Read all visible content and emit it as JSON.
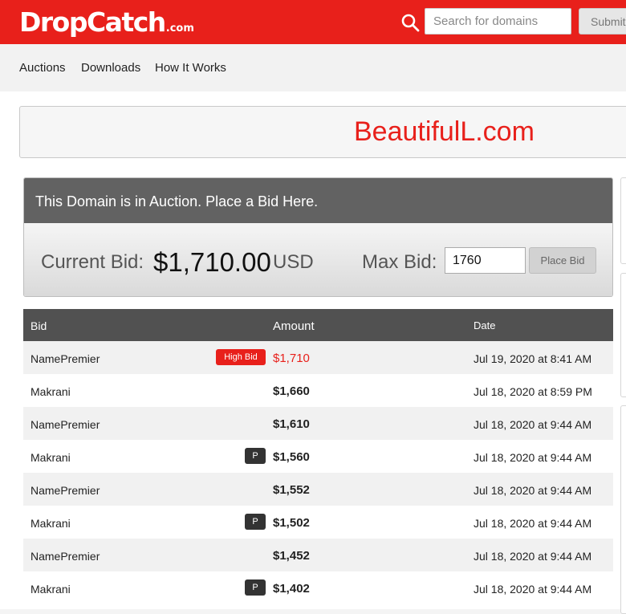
{
  "brand": {
    "logo_main": "DropCatch",
    "logo_suffix": ".com",
    "accent": "#e8201b"
  },
  "search": {
    "placeholder": "Search for domains",
    "submit_label": "Submit"
  },
  "nav": {
    "items": [
      "Auctions",
      "Downloads",
      "How It Works"
    ]
  },
  "domain": {
    "name": "BeautifulL.com"
  },
  "auction": {
    "header": "This Domain is in Auction. Place a Bid Here.",
    "current_bid_label": "Current Bid:",
    "current_bid_amount": "$1,710.00",
    "currency": "USD",
    "max_bid_label": "Max Bid:",
    "max_bid_value": "1760",
    "place_bid_label": "Place Bid"
  },
  "bids": {
    "headers": {
      "bid": "Bid",
      "amount": "Amount",
      "date": "Date"
    },
    "high_bid_badge": "High Bid",
    "proxy_badge": "P",
    "rows": [
      {
        "bidder": "NamePremier",
        "amount": "$1,710",
        "date": "Jul 19, 2020 at 8:41 AM",
        "badge": "high"
      },
      {
        "bidder": "Makrani",
        "amount": "$1,660",
        "date": "Jul 18, 2020 at 8:59 PM",
        "badge": ""
      },
      {
        "bidder": "NamePremier",
        "amount": "$1,610",
        "date": "Jul 18, 2020 at 9:44 AM",
        "badge": ""
      },
      {
        "bidder": "Makrani",
        "amount": "$1,560",
        "date": "Jul 18, 2020 at 9:44 AM",
        "badge": "P"
      },
      {
        "bidder": "NamePremier",
        "amount": "$1,552",
        "date": "Jul 18, 2020 at 9:44 AM",
        "badge": ""
      },
      {
        "bidder": "Makrani",
        "amount": "$1,502",
        "date": "Jul 18, 2020 at 9:44 AM",
        "badge": "P"
      },
      {
        "bidder": "NamePremier",
        "amount": "$1,452",
        "date": "Jul 18, 2020 at 9:44 AM",
        "badge": ""
      },
      {
        "bidder": "Makrani",
        "amount": "$1,402",
        "date": "Jul 18, 2020 at 9:44 AM",
        "badge": "P"
      }
    ]
  }
}
